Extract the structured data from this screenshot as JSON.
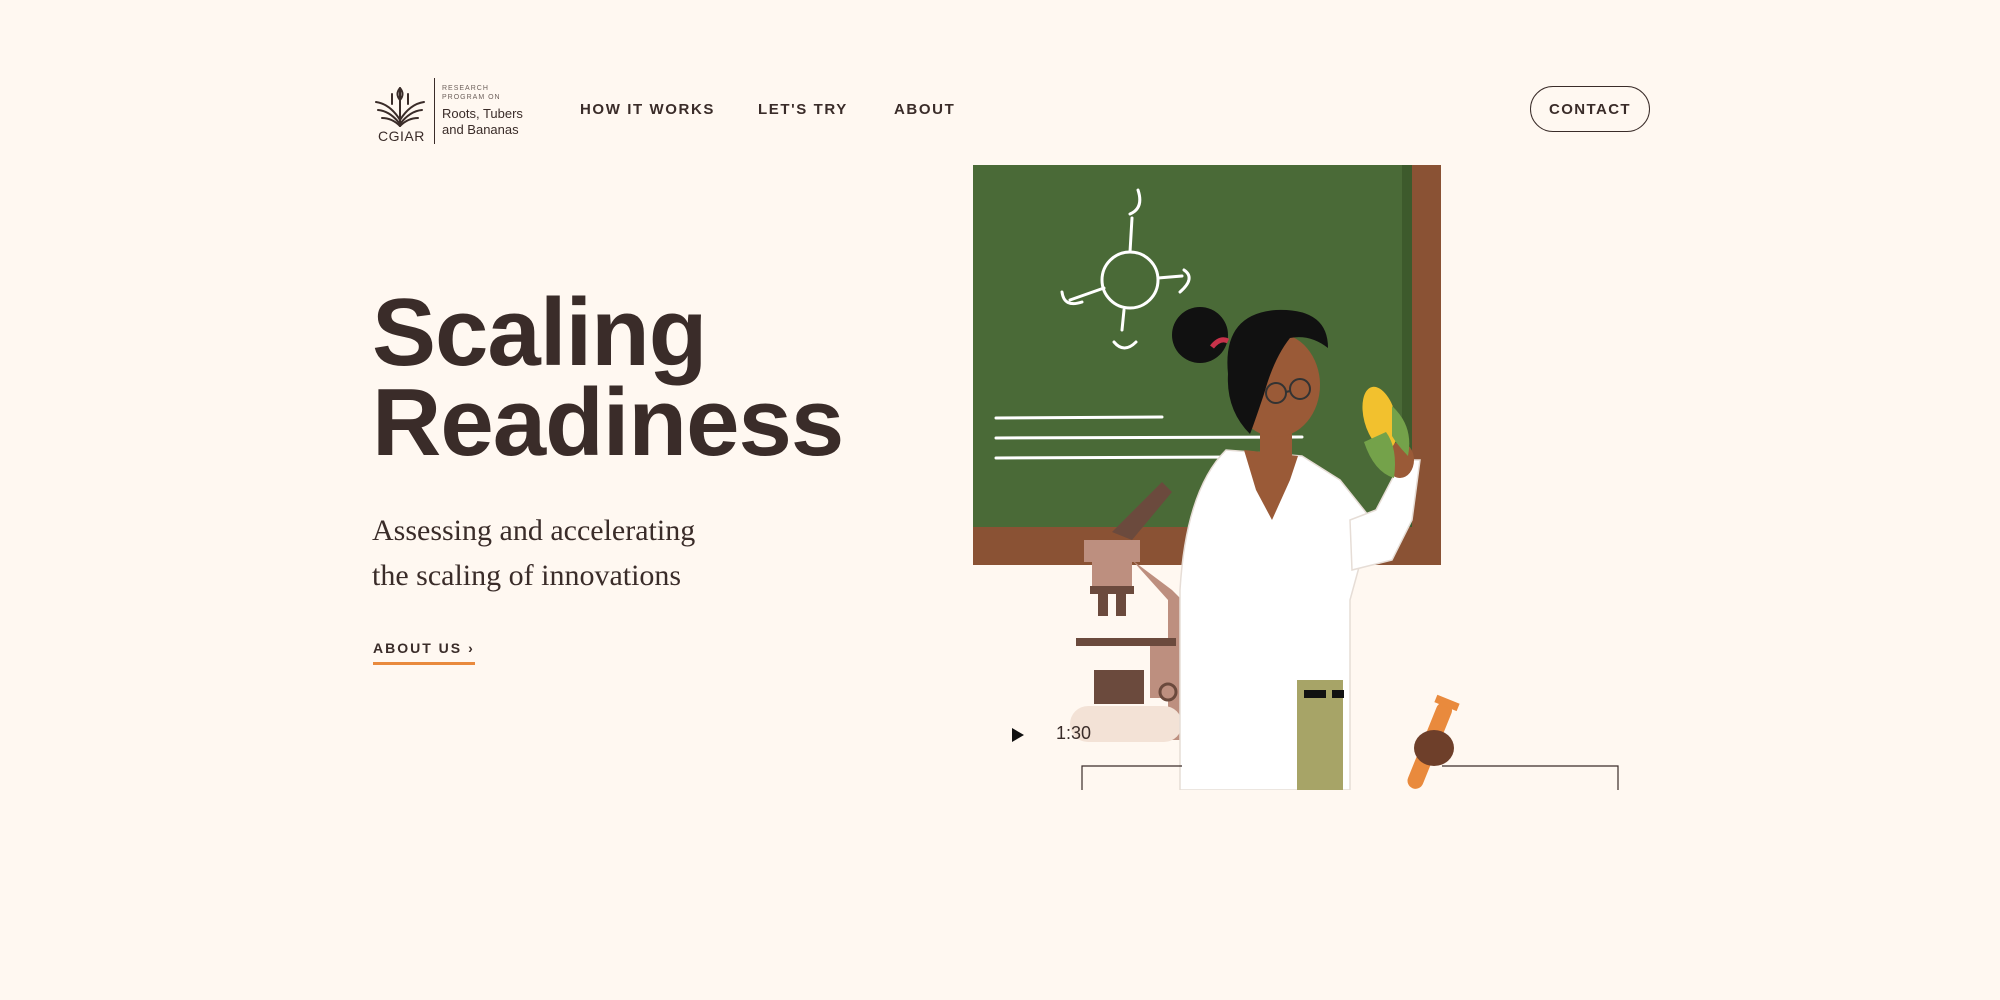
{
  "logo": {
    "org": "CGIAR",
    "program_small": "RESEARCH PROGRAM ON",
    "program_name": "Roots, Tubers and Bananas"
  },
  "nav": {
    "items": [
      {
        "label": "HOW IT WORKS"
      },
      {
        "label": "LET'S TRY"
      },
      {
        "label": "ABOUT"
      }
    ],
    "contact_label": "CONTACT"
  },
  "hero": {
    "title_line1": "Scaling",
    "title_line2": "Readiness",
    "subtitle_line1": "Assessing and accelerating",
    "subtitle_line2": "the scaling of innovations",
    "cta_label": "ABOUT US",
    "cta_chevron": "›"
  },
  "video": {
    "duration": "1:30",
    "play_icon": "play-icon"
  },
  "colors": {
    "background": "#fff8f1",
    "text": "#3a2c29",
    "accent_underline": "#e98a3d",
    "chalkboard": "#4a6a37",
    "chalkboard_frame": "#8a5234"
  }
}
